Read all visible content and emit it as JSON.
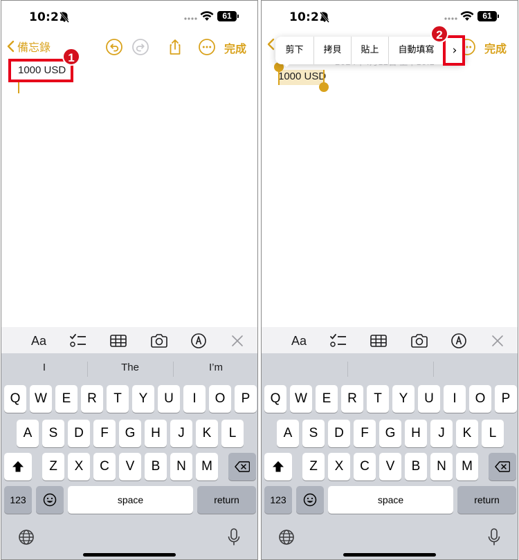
{
  "status": {
    "time": "10:21",
    "battery": "61"
  },
  "nav": {
    "back_label": "備忘錄",
    "done_label": "完成"
  },
  "note": {
    "text": "1000 USD",
    "faded_date": "2024年4月12日 上午10:2"
  },
  "context_menu": {
    "items": [
      "剪下",
      "拷貝",
      "貼上",
      "自動填寫"
    ],
    "more": "›"
  },
  "annotations": {
    "step1": "1",
    "step2": "2"
  },
  "toolbar": {
    "format_label": "Aa"
  },
  "keyboard": {
    "suggestions_left": [
      "I",
      "The",
      "I’m"
    ],
    "suggestions_right": [
      "",
      "",
      ""
    ],
    "row1": [
      "Q",
      "W",
      "E",
      "R",
      "T",
      "Y",
      "U",
      "I",
      "O",
      "P"
    ],
    "row2": [
      "A",
      "S",
      "D",
      "F",
      "G",
      "H",
      "J",
      "K",
      "L"
    ],
    "row3": [
      "Z",
      "X",
      "C",
      "V",
      "B",
      "N",
      "M"
    ],
    "numbers_label": "123",
    "space_label": "space",
    "return_label": "return"
  },
  "colors": {
    "accent": "#d9a21c",
    "annotation": "#e6001a",
    "keyboard_bg": "#d1d4da"
  }
}
